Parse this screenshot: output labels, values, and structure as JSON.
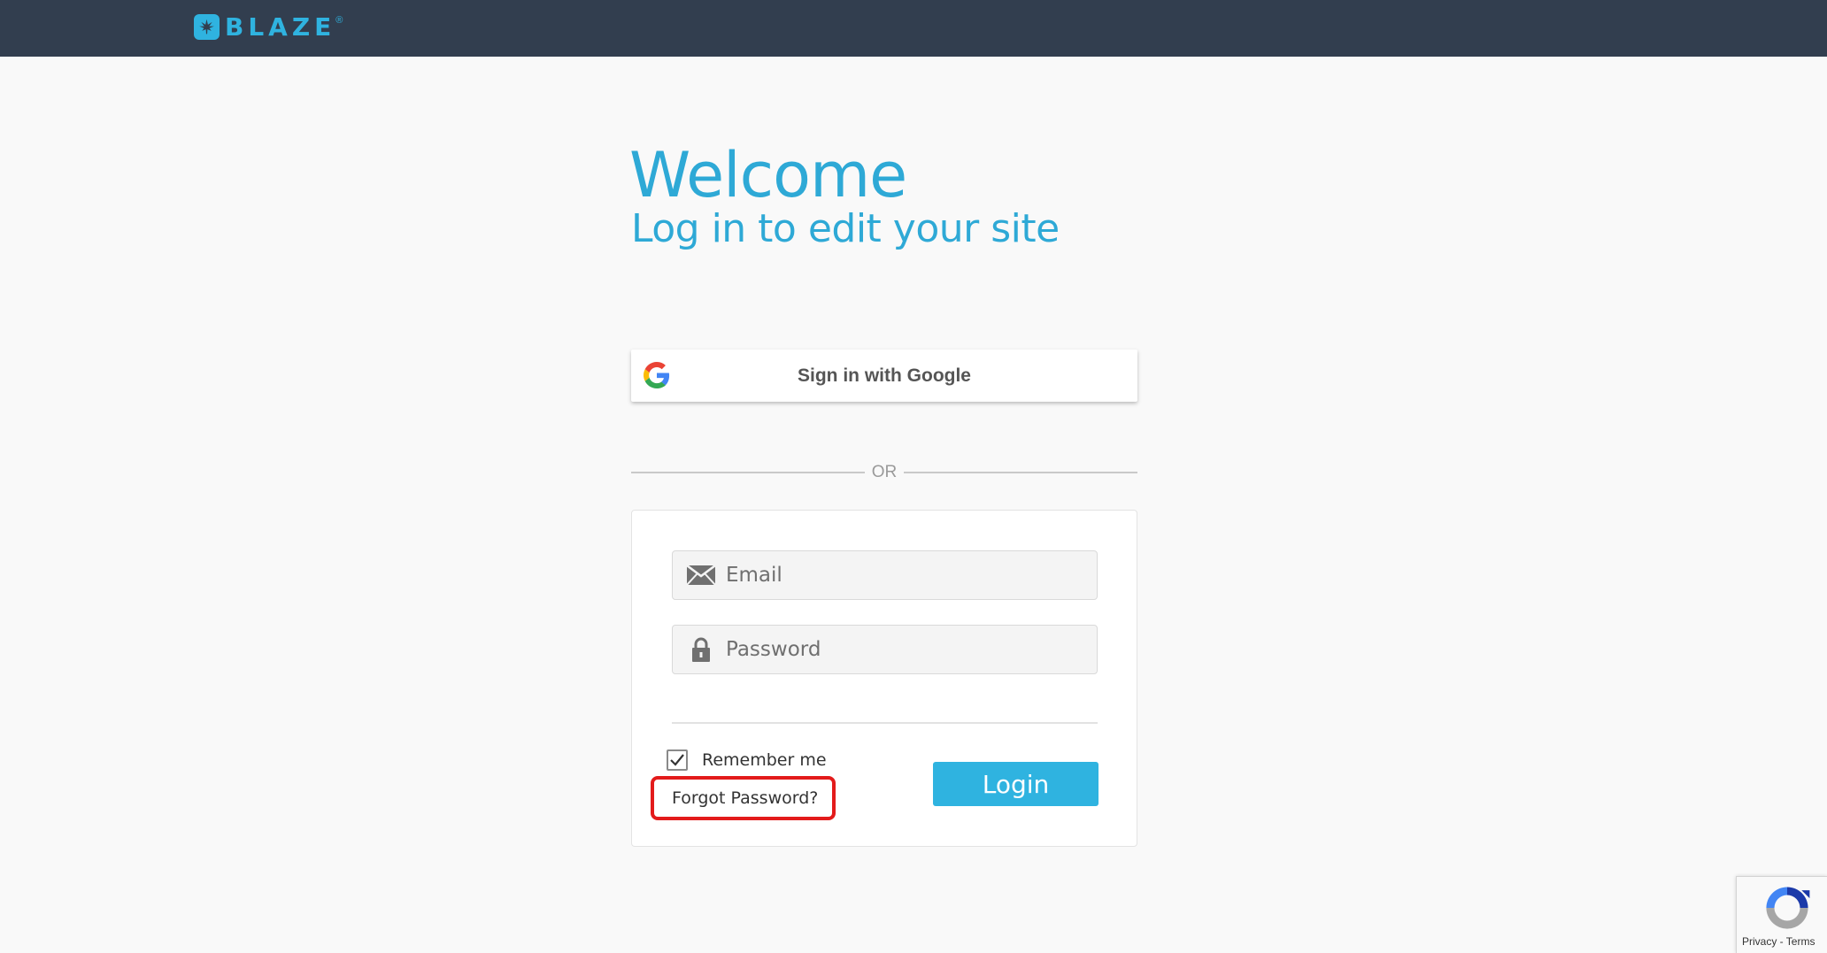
{
  "header": {
    "brand": "BLAZE",
    "registered_mark": "®",
    "bg_color": "#323e4f",
    "brand_color": "#2fb3e0"
  },
  "hero": {
    "title": "Welcome",
    "subtitle": "Log in to edit your site"
  },
  "google": {
    "label": "Sign in with Google",
    "icon": "google-icon"
  },
  "separator": {
    "text": "OR"
  },
  "form": {
    "email": {
      "placeholder": "Email",
      "value": "",
      "icon": "envelope-icon"
    },
    "password": {
      "placeholder": "Password",
      "value": "",
      "icon": "lock-icon"
    },
    "remember": {
      "label": "Remember me",
      "checked": true
    },
    "forgot_label": "Forgot Password?",
    "login_label": "Login",
    "highlight_color": "#e31b1b"
  },
  "recaptcha": {
    "privacy": "Privacy",
    "separator": " - ",
    "terms": "Terms"
  }
}
